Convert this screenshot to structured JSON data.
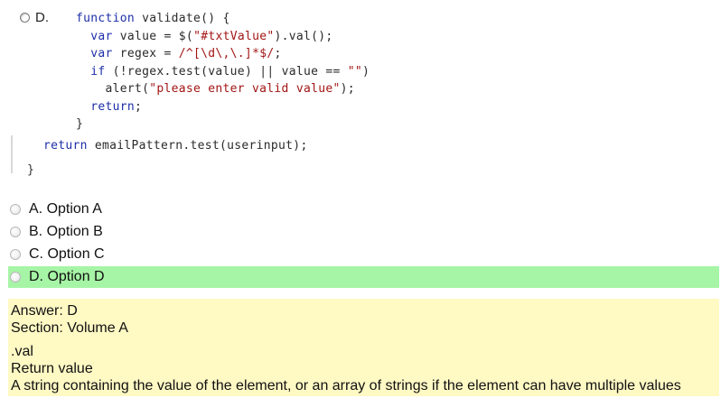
{
  "question": {
    "option_d_label": "D.",
    "code_lines": [
      {
        "indent": "",
        "parts": [
          {
            "t": "function",
            "c": "kw"
          },
          {
            "t": " validate() {",
            "c": "plain"
          }
        ]
      },
      {
        "indent": "  ",
        "parts": [
          {
            "t": "var",
            "c": "kw"
          },
          {
            "t": " value = $(",
            "c": "plain"
          },
          {
            "t": "\"#txtValue\"",
            "c": "str"
          },
          {
            "t": ").val();",
            "c": "plain"
          }
        ]
      },
      {
        "indent": "  ",
        "parts": [
          {
            "t": "var",
            "c": "kw"
          },
          {
            "t": " regex = ",
            "c": "plain"
          },
          {
            "t": "/^[\\d\\,\\.]*$/",
            "c": "str"
          },
          {
            "t": ";",
            "c": "plain"
          }
        ]
      },
      {
        "indent": "  ",
        "parts": [
          {
            "t": "if",
            "c": "kw"
          },
          {
            "t": " (!regex.test(value) || value == ",
            "c": "plain"
          },
          {
            "t": "\"\"",
            "c": "str"
          },
          {
            "t": ")",
            "c": "plain"
          }
        ]
      },
      {
        "indent": "    ",
        "parts": [
          {
            "t": "alert(",
            "c": "plain"
          },
          {
            "t": "\"please enter valid value\"",
            "c": "str"
          },
          {
            "t": ");",
            "c": "plain"
          }
        ]
      },
      {
        "indent": "  ",
        "parts": [
          {
            "t": "return",
            "c": "kw"
          },
          {
            "t": ";",
            "c": "plain"
          }
        ]
      },
      {
        "indent": "",
        "parts": [
          {
            "t": "}",
            "c": "plain"
          }
        ]
      }
    ],
    "return_line": [
      {
        "t": "return",
        "c": "kw"
      },
      {
        "t": " emailPattern.test(userinput);",
        "c": "plain"
      }
    ],
    "closing_brace": "}"
  },
  "options": [
    {
      "label": "A. Option A",
      "selected": false
    },
    {
      "label": "B. Option B",
      "selected": false
    },
    {
      "label": "C. Option C",
      "selected": false
    },
    {
      "label": "D. Option D",
      "selected": true
    }
  ],
  "answer_panel": {
    "answer": "Answer: D",
    "section": "Section: Volume A",
    "explanation_lines": [
      ".val",
      "Return value",
      "A string containing the value of the element, or an array of strings if the element can have multiple values"
    ]
  },
  "colors": {
    "selected_option_bg": "#a6f5a6",
    "answer_panel_bg": "#fff9c4",
    "keyword": "#1d2fa8",
    "string": "#a31515"
  }
}
